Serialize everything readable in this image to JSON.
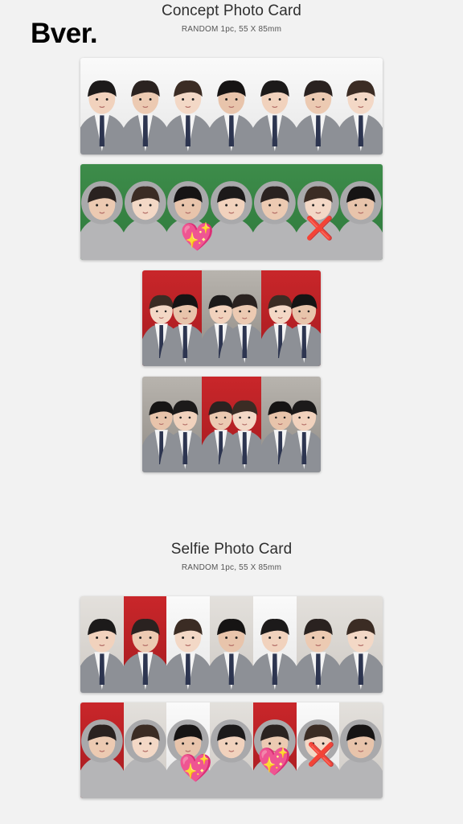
{
  "badge": "Bver.",
  "concept": {
    "title": "Concept Photo Card",
    "subtitle": "RANDOM 1pc, 55 X 85mm"
  },
  "selfie": {
    "title": "Selfie Photo Card",
    "subtitle": "RANDOM 1pc, 55 X 85mm"
  },
  "rows": [
    {
      "id": "concept-row-1",
      "cards": [
        "white",
        "white",
        "white",
        "white",
        "white",
        "white",
        "white"
      ],
      "clothes": "uniform"
    },
    {
      "id": "concept-row-2",
      "cards": [
        "green",
        "green",
        "green",
        "green",
        "green",
        "green",
        "green"
      ],
      "clothes": "hoodie"
    },
    {
      "id": "concept-group-1",
      "cards": [
        "red",
        "party",
        "red"
      ],
      "clothes": "uniform"
    },
    {
      "id": "concept-group-2",
      "cards": [
        "party",
        "red",
        "party"
      ],
      "clothes": "uniform"
    },
    {
      "id": "selfie-row-1",
      "cards": [
        "gray",
        "red",
        "white",
        "gray",
        "white",
        "gray",
        "gray"
      ],
      "clothes": "uniform"
    },
    {
      "id": "selfie-row-2",
      "cards": [
        "red",
        "gray",
        "white",
        "gray",
        "red",
        "white",
        "gray"
      ],
      "clothes": "hoodie"
    }
  ],
  "stickers": {
    "heart": "💖",
    "cross": "❌"
  },
  "colors": {
    "background": "#f2f2f2",
    "green_bg": "#3a8746",
    "red_bg": "#c0232a",
    "uniform_gray": "#8d9096",
    "hoodie_gray": "#b7b7b9"
  }
}
